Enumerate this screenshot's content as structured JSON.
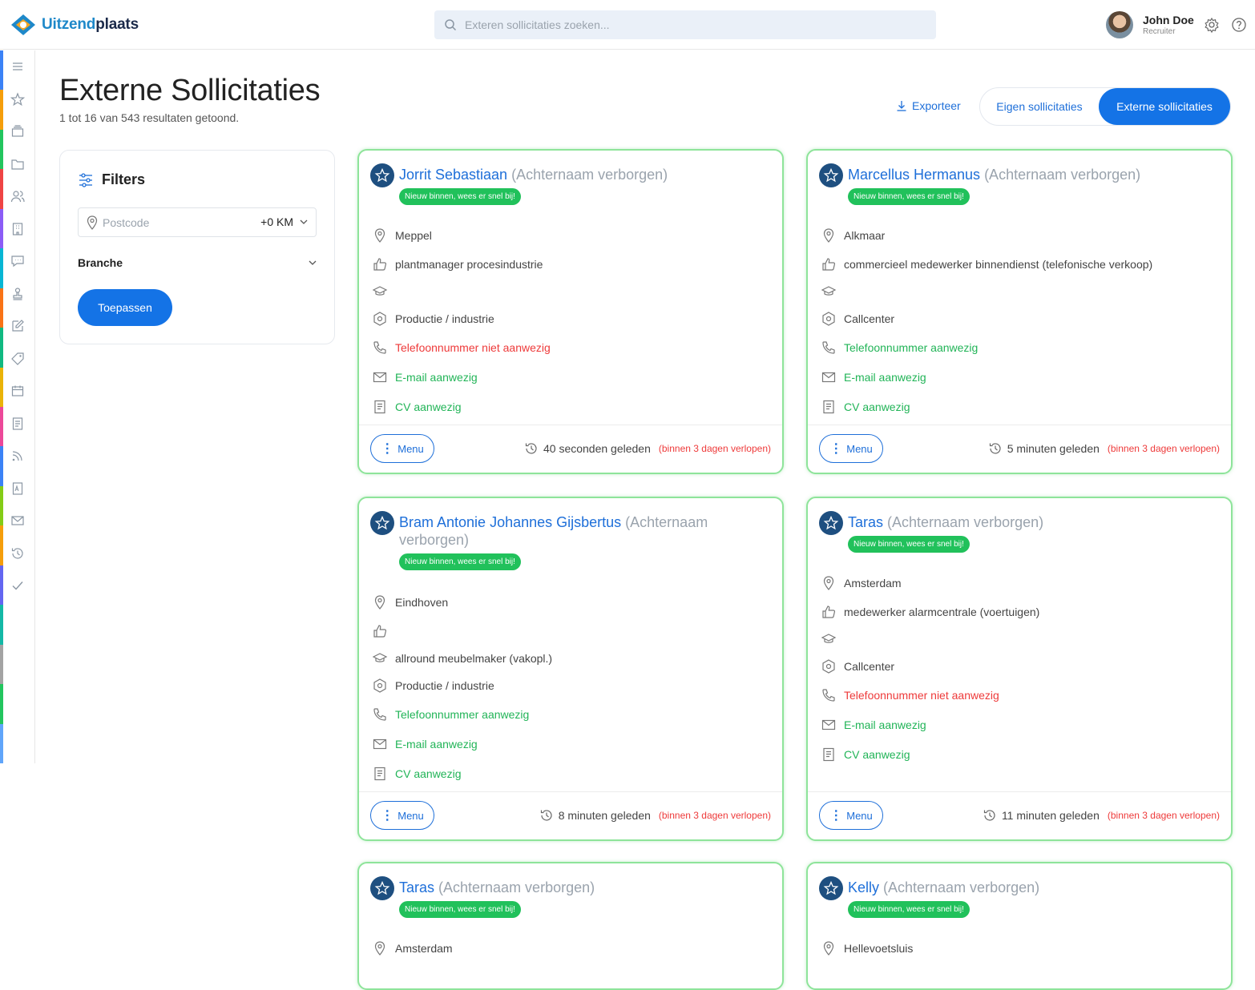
{
  "header": {
    "brand_a": "Uitzend",
    "brand_b": "plaats",
    "search_placeholder": "Exteren sollicitaties zoeken...",
    "user_name": "John Doe",
    "user_role": "Recruiter"
  },
  "sidebar": {
    "icons": [
      "menu-icon",
      "star-icon",
      "stack-icon",
      "folder-icon",
      "users-icon",
      "building-icon",
      "chat-icon",
      "stamp-icon",
      "edit-icon",
      "tag-icon",
      "calendar-icon",
      "document-icon",
      "rss-icon",
      "pdf-icon",
      "mail-icon",
      "history-icon",
      "check-icon"
    ],
    "stripe_colors": [
      "#3b82f6",
      "#f59e0b",
      "#22c55e",
      "#ef4444",
      "#8b5cf6",
      "#06b6d4",
      "#f97316",
      "#10b981",
      "#eab308",
      "#ec4899",
      "#3b82f6",
      "#84cc16",
      "#f59e0b",
      "#6366f1",
      "#14b8a6",
      "#a3a3a3",
      "#22c55e",
      "#60a5fa"
    ]
  },
  "page": {
    "title": "Externe Sollicitaties",
    "subtitle": "1 tot 16 van 543 resultaten getoond.",
    "export_label": "Exporteer",
    "tab_own": "Eigen sollicitaties",
    "tab_external": "Externe sollicitaties"
  },
  "filters": {
    "title": "Filters",
    "postcode_placeholder": "Postcode",
    "km_value": "+0 KM",
    "branche_label": "Branche",
    "apply_label": "Toepassen"
  },
  "cards": [
    {
      "first_name": "Jorrit Sebastiaan",
      "hidden_label": "(Achternaam verborgen)",
      "tag": "Nieuw binnen, wees er snel bij!",
      "location": "Meppel",
      "job": "plantmanager procesindustrie",
      "education": "",
      "industry": "Productie / industrie",
      "phone": "Telefoonnummer niet aanwezig",
      "phone_status": "red",
      "email": "E-mail aanwezig",
      "cv": "CV aanwezig",
      "menu": "Menu",
      "time": "40 seconden geleden",
      "expire": "(binnen 3 dagen verlopen)"
    },
    {
      "first_name": "Marcellus Hermanus",
      "hidden_label": "(Achternaam verborgen)",
      "tag": "Nieuw binnen, wees er snel bij!",
      "location": "Alkmaar",
      "job": "commercieel medewerker binnendienst (telefonische verkoop)",
      "education": "",
      "industry": "Callcenter",
      "phone": "Telefoonnummer aanwezig",
      "phone_status": "green",
      "email": "E-mail aanwezig",
      "cv": "CV aanwezig",
      "menu": "Menu",
      "time": "5 minuten geleden",
      "expire": "(binnen 3 dagen verlopen)"
    },
    {
      "first_name": "Bram Antonie Johannes Gijsbertus",
      "hidden_label": "(Achternaam verborgen)",
      "tag": "Nieuw binnen, wees er snel bij!",
      "location": "Eindhoven",
      "job": "",
      "education": "allround meubelmaker (vakopl.)",
      "industry": "Productie / industrie",
      "phone": "Telefoonnummer aanwezig",
      "phone_status": "green",
      "email": "E-mail aanwezig",
      "cv": "CV aanwezig",
      "menu": "Menu",
      "time": "8 minuten geleden",
      "expire": "(binnen 3 dagen verlopen)"
    },
    {
      "first_name": "Taras",
      "hidden_label": "(Achternaam verborgen)",
      "tag": "Nieuw binnen, wees er snel bij!",
      "location": "Amsterdam",
      "job": "medewerker alarmcentrale (voertuigen)",
      "education": "",
      "industry": "Callcenter",
      "phone": "Telefoonnummer niet aanwezig",
      "phone_status": "red",
      "email": "E-mail aanwezig",
      "cv": "CV aanwezig",
      "menu": "Menu",
      "time": "11 minuten geleden",
      "expire": "(binnen 3 dagen verlopen)"
    },
    {
      "first_name": "Taras",
      "hidden_label": "(Achternaam verborgen)",
      "tag": "Nieuw binnen, wees er snel bij!",
      "location": "Amsterdam"
    },
    {
      "first_name": "Kelly",
      "hidden_label": "(Achternaam verborgen)",
      "tag": "Nieuw binnen, wees er snel bij!",
      "location": "Hellevoetsluis"
    }
  ]
}
